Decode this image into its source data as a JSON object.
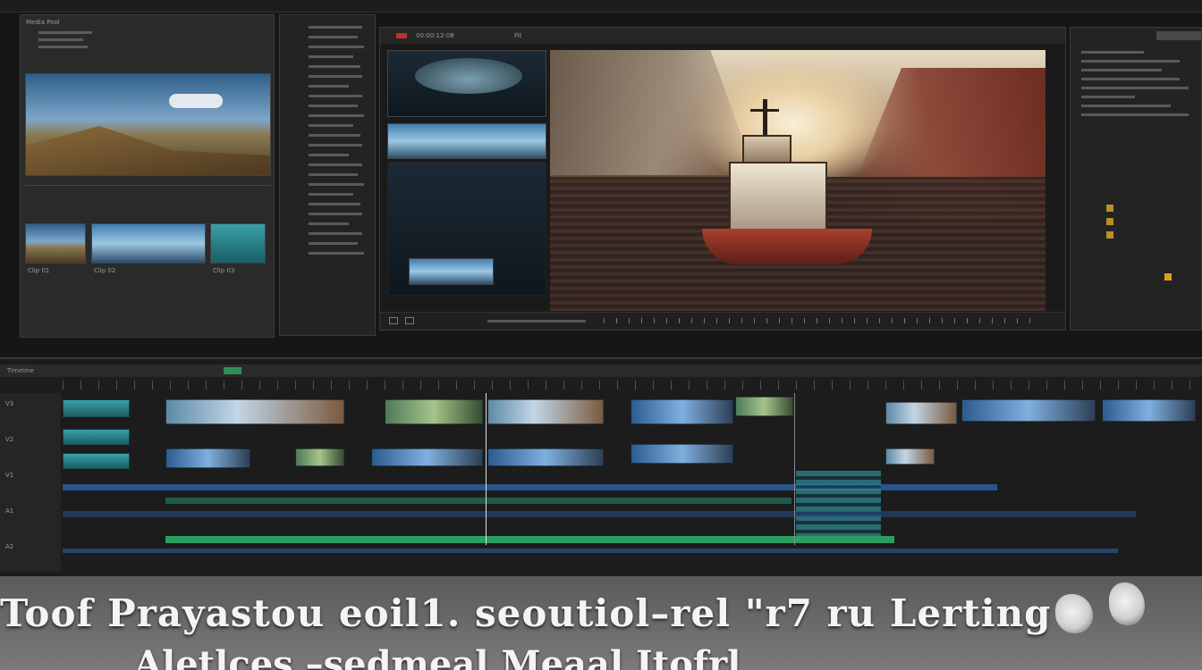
{
  "media_bin": {
    "panel_label": "Media Pool",
    "clip_labels": [
      "Clip 01",
      "Clip 02",
      "Clip 03"
    ]
  },
  "viewer": {
    "timecode": "00:00:12:08",
    "zoom": "Fit"
  },
  "timeline": {
    "label": "Timeline",
    "track_names": [
      "V3",
      "V2",
      "V1",
      "A1",
      "A2"
    ]
  },
  "caption": {
    "line1": "Toof Prayastou eoil1. seoutiol–rel \"r7 ru Lerting",
    "line2": "Aletlces –sedmeal  Meaal Itofrl"
  },
  "colors": {
    "background": "#101010",
    "panel": "#2a2a2a",
    "track_green": "#2a8f6a",
    "track_blue": "#2e5f9e"
  }
}
